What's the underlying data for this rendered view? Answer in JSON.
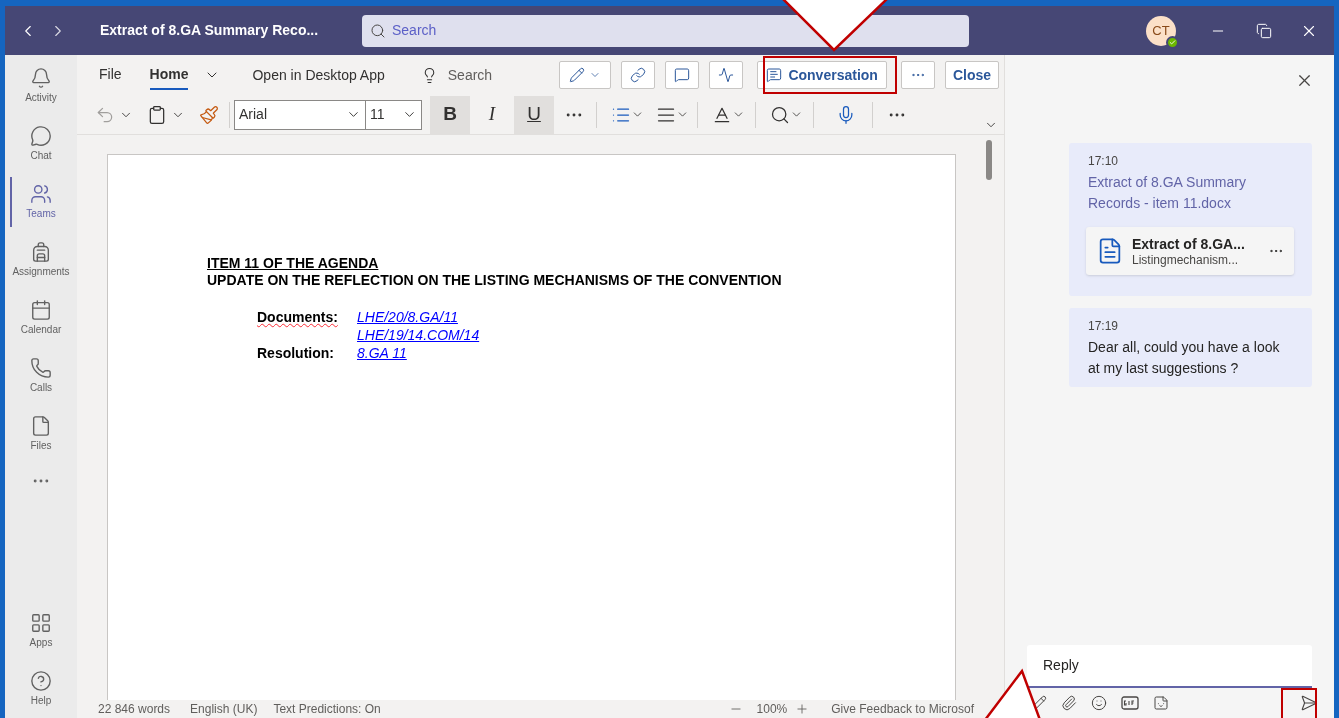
{
  "window": {
    "title": "Extract of 8.GA Summary Reco...",
    "search_placeholder": "Search",
    "avatar_initials": "CT",
    "presence_available": true
  },
  "rail": [
    {
      "label": "Activity",
      "selected": false
    },
    {
      "label": "Chat",
      "selected": false
    },
    {
      "label": "Teams",
      "selected": true
    },
    {
      "label": "Assignments",
      "selected": false
    },
    {
      "label": "Calendar",
      "selected": false
    },
    {
      "label": "Calls",
      "selected": false
    },
    {
      "label": "Files",
      "selected": false
    }
  ],
  "rail_bottom": [
    {
      "label": "Apps",
      "selected": false
    },
    {
      "label": "Help",
      "selected": false
    }
  ],
  "ribbon_tabs": [
    {
      "label": "File",
      "selected": false
    },
    {
      "label": "Home",
      "selected": true
    }
  ],
  "open_desktop": "Open in Desktop App",
  "ribbon_search_placeholder": "Search",
  "ribbon_buttons": {
    "conversation": "Conversation",
    "close": "Close"
  },
  "format": {
    "font": "Arial",
    "size": "11",
    "bold": {
      "label": "B",
      "on": true
    },
    "italic": {
      "label": "I",
      "on": false
    },
    "underline": {
      "label": "U",
      "on": true
    }
  },
  "document": {
    "heading": "ITEM 11 OF THE AGENDA",
    "title": "UPDATE ON THE REFLECTION ON THE LISTING MECHANISMS OF THE CONVENTION",
    "rows": [
      {
        "label": "Documents:",
        "spell_error": true,
        "links": [
          "LHE/20/8.GA/11",
          "LHE/19/14.COM/14"
        ]
      },
      {
        "label": "Resolution:",
        "spell_error": false,
        "links": [
          "8.GA 11"
        ]
      }
    ]
  },
  "status_bar": {
    "words": "22 846 words",
    "language": "English (UK)",
    "predictions": "Text Predictions: On",
    "zoom": "100%",
    "feedback": "Give Feedback to Microsof"
  },
  "conversation": {
    "messages": [
      {
        "kind": "file",
        "time": "17:10",
        "link": "Extract of 8.GA Summary Records - item 11.docx",
        "attachment": {
          "name": "Extract of 8.GA...",
          "subtitle": "Listingmechanism..."
        }
      },
      {
        "kind": "text",
        "time": "17:19",
        "text": "Dear all, could you have a look at my last suggestions ?"
      }
    ],
    "reply_placeholder": "Reply"
  }
}
